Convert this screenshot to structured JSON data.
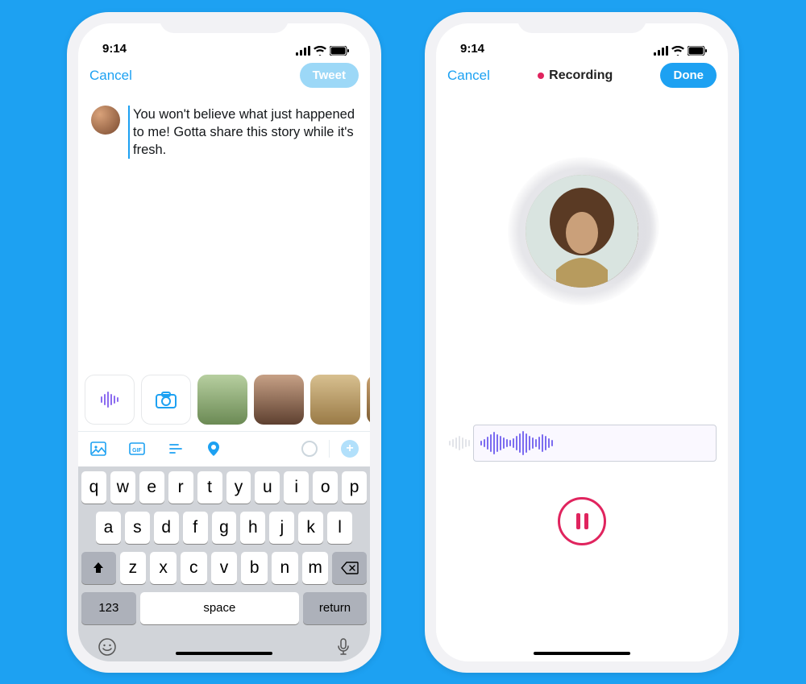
{
  "status": {
    "time": "9:14"
  },
  "compose": {
    "cancel": "Cancel",
    "tweet_btn": "Tweet",
    "tweet_text": "You won't believe what just happened to me! Gotta share this story while it's fresh."
  },
  "keyboard": {
    "row1": [
      "q",
      "w",
      "e",
      "r",
      "t",
      "y",
      "u",
      "i",
      "o",
      "p"
    ],
    "row2": [
      "a",
      "s",
      "d",
      "f",
      "g",
      "h",
      "j",
      "k",
      "l"
    ],
    "row3": [
      "z",
      "x",
      "c",
      "v",
      "b",
      "n",
      "m"
    ],
    "num": "123",
    "space": "space",
    "ret": "return"
  },
  "recording": {
    "cancel": "Cancel",
    "status": "Recording",
    "done": "Done"
  },
  "colors": {
    "brand": "#1DA1F2",
    "record": "#e0245e",
    "wave": "#7c6cf0"
  }
}
